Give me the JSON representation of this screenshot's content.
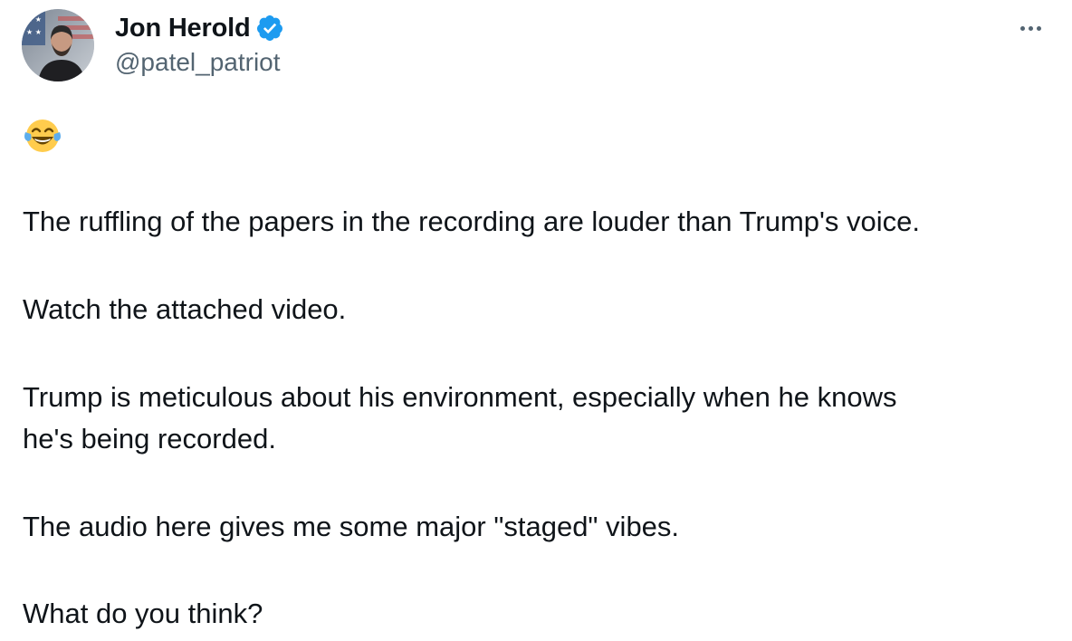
{
  "author": {
    "display_name": "Jon Herold",
    "handle": "@patel_patriot",
    "verified": true,
    "avatar": "profile-photo-man-with-beard-flag-background"
  },
  "icons": {
    "verified": "verified-badge-icon",
    "more": "more-horizontal-icon",
    "emoji": "face-with-tears-of-joy-emoji"
  },
  "colors": {
    "verified_blue": "#1d9bf0",
    "text_primary": "#0f1419",
    "text_secondary": "#536471"
  },
  "tweet": {
    "emoji": "face-with-tears-of-joy",
    "lines": [
      "The ruffling of the papers in the recording are louder than Trump's voice.",
      "Watch the attached video.",
      "Trump is meticulous about his environment, especially when he knows",
      "he's being recorded.",
      "The audio here gives me some major \"staged\" vibes.",
      "What do you think?"
    ]
  }
}
